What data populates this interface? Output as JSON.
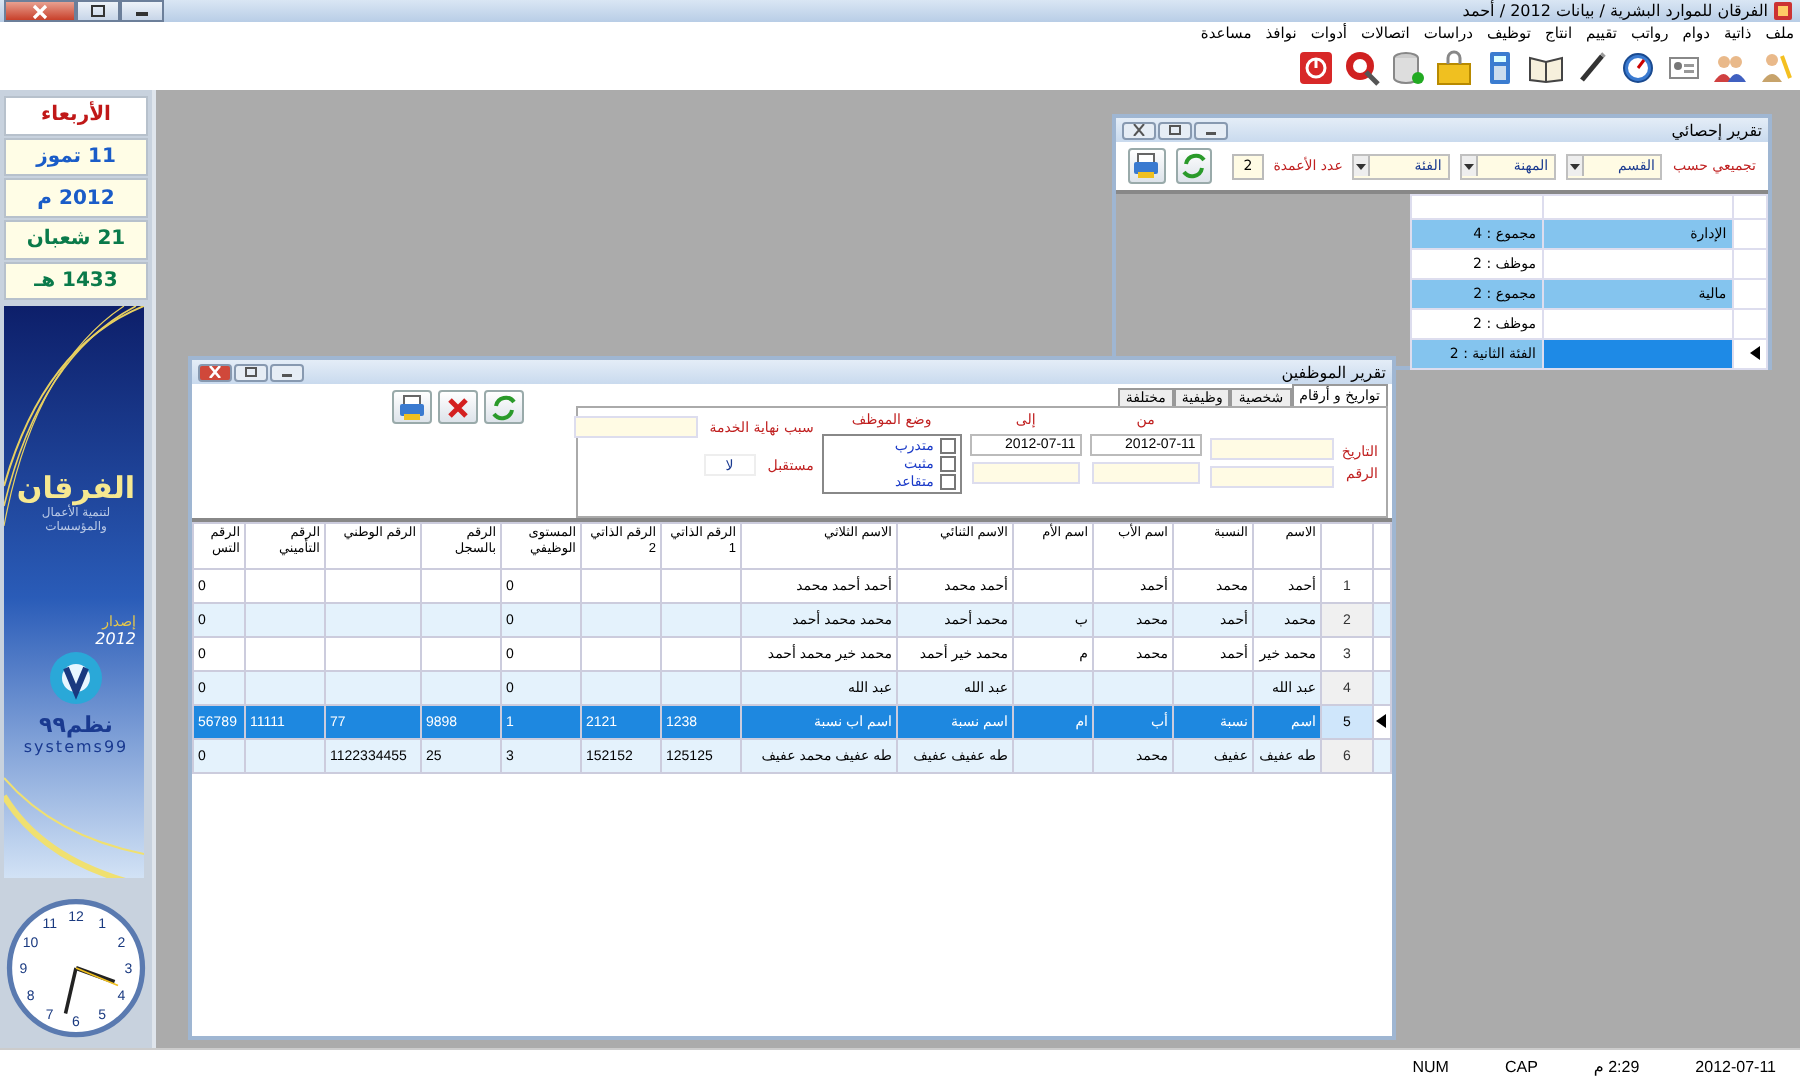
{
  "window": {
    "title": "الفرقان للموارد البشرية / بيانات 2012 / أحمد"
  },
  "menu": [
    "ملف",
    "ذاتية",
    "دوام",
    "رواتب",
    "تقييم",
    "انتاج",
    "توظيف",
    "دراسات",
    "اتصالات",
    "أدوات",
    "نوافذ",
    "مساعدة"
  ],
  "sidebar": {
    "date_lines": [
      {
        "text": "الأربعاء",
        "kind": "day"
      },
      {
        "text": "11 تموز",
        "kind": "gregorian"
      },
      {
        "text": "2012 م",
        "kind": "gregorian"
      },
      {
        "text": "21 شعبان",
        "kind": "hijri"
      },
      {
        "text": "1433 هـ",
        "kind": "hijri"
      }
    ],
    "banner": {
      "brand": "الفرقان",
      "tagline": "لتنمية الأعمال والمؤسسات",
      "edition": "إصدار",
      "year": "2012",
      "company": "نظم٩٩",
      "company_latin": "systems99"
    },
    "clock": {
      "numbers": [
        "12",
        "1",
        "2",
        "3",
        "4",
        "5",
        "6",
        "7",
        "8",
        "9",
        "10",
        "11"
      ]
    }
  },
  "stats_window": {
    "title": "تقرير إحصائي",
    "group_by_label": "تجميعي حسب",
    "group_fields": [
      "القسم",
      "المهنة",
      "الفئة"
    ],
    "columns_label": "عدد الأعمدة",
    "columns_value": "2",
    "rows": [
      {
        "kind": "group",
        "col_1": "الإدارة",
        "col_2": "مجموع : 4",
        "selected": false
      },
      {
        "kind": "item",
        "col_2": "موظف : 2",
        "selected": false
      },
      {
        "kind": "group",
        "col_1": "مالية",
        "col_2": "مجموع : 2",
        "selected": false
      },
      {
        "kind": "item",
        "col_2": "موظف : 2",
        "selected": false
      },
      {
        "kind": "item",
        "col_2": "الفئة الثانية : 2",
        "selected": true
      }
    ]
  },
  "employees_window": {
    "title": "تقرير الموظفين",
    "tabs": [
      {
        "label": "تواريخ و أرقام",
        "selected": true
      },
      {
        "label": "شخصية",
        "selected": false
      },
      {
        "label": "وظيفية",
        "selected": false
      },
      {
        "label": "مختلفة",
        "selected": false
      }
    ],
    "filters": {
      "date_label": "التاريخ",
      "number_label": "الرقم",
      "from_label": "من",
      "to_label": "إلى",
      "from_date": "2012-07-11",
      "to_date": "2012-07-11",
      "status_label": "وضع الموظف",
      "statuses": [
        {
          "label": "متدرب",
          "checked": false
        },
        {
          "label": "مثبت",
          "checked": false
        },
        {
          "label": "متقاعد",
          "checked": false
        }
      ],
      "end_reason_label": "سبب نهاية الخدمة",
      "future_label": "مستقبل",
      "future_value": "لا"
    },
    "table": {
      "columns": [
        "الاسم",
        "النسبة",
        "اسم الأب",
        "اسم الأم",
        "الاسم الثنائي",
        "الاسم الثلاثي",
        "الرقم الذاتي 1",
        "الرقم الذاتي 2",
        "المستوى الوظيفي",
        "الرقم بالسجل",
        "الرقم الوطني",
        "الرقم التأميني",
        "الرقم التس"
      ],
      "rows": [
        {
          "number": "1",
          "selected": false,
          "cells": [
            "أحمد",
            "محمد",
            "أحمد",
            null,
            "أحمد محمد",
            "أحمد أحمد محمد",
            null,
            null,
            "0",
            null,
            null,
            null,
            "0"
          ]
        },
        {
          "number": "2",
          "selected": false,
          "cells": [
            "محمد",
            "أحمد",
            "محمد",
            "ب",
            "محمد أحمد",
            "محمد محمد أحمد",
            null,
            null,
            "0",
            null,
            null,
            null,
            "0"
          ]
        },
        {
          "number": "3",
          "selected": false,
          "cells": [
            "محمد خير",
            "أحمد",
            "محمد",
            "م",
            "محمد خير أحمد",
            "محمد خير محمد أحمد",
            null,
            null,
            "0",
            null,
            null,
            null,
            "0"
          ]
        },
        {
          "number": "4",
          "selected": false,
          "cells": [
            "عبد الله",
            null,
            null,
            null,
            "عبد الله",
            "عبد الله",
            null,
            null,
            "0",
            null,
            null,
            null,
            "0"
          ]
        },
        {
          "number": "5",
          "selected": true,
          "cells": [
            "اسم",
            "نسبة",
            "أب",
            "ام",
            "اسم نسبة",
            "اسم اب نسبة",
            "1238",
            "2121",
            "1",
            "9898",
            "77",
            "11111",
            "56789"
          ]
        },
        {
          "number": "6",
          "selected": false,
          "cells": [
            "طه عفيف",
            "عفيف",
            "محمد",
            null,
            "طه عفيف عفيف",
            "طه عفيف محمد عفيف",
            "125125",
            "152152",
            "3",
            "25",
            "1122334455",
            null,
            "0"
          ]
        }
      ]
    }
  },
  "status_bar": [
    "2012-07-11",
    "2:29 م",
    "CAP",
    "NUM"
  ]
}
